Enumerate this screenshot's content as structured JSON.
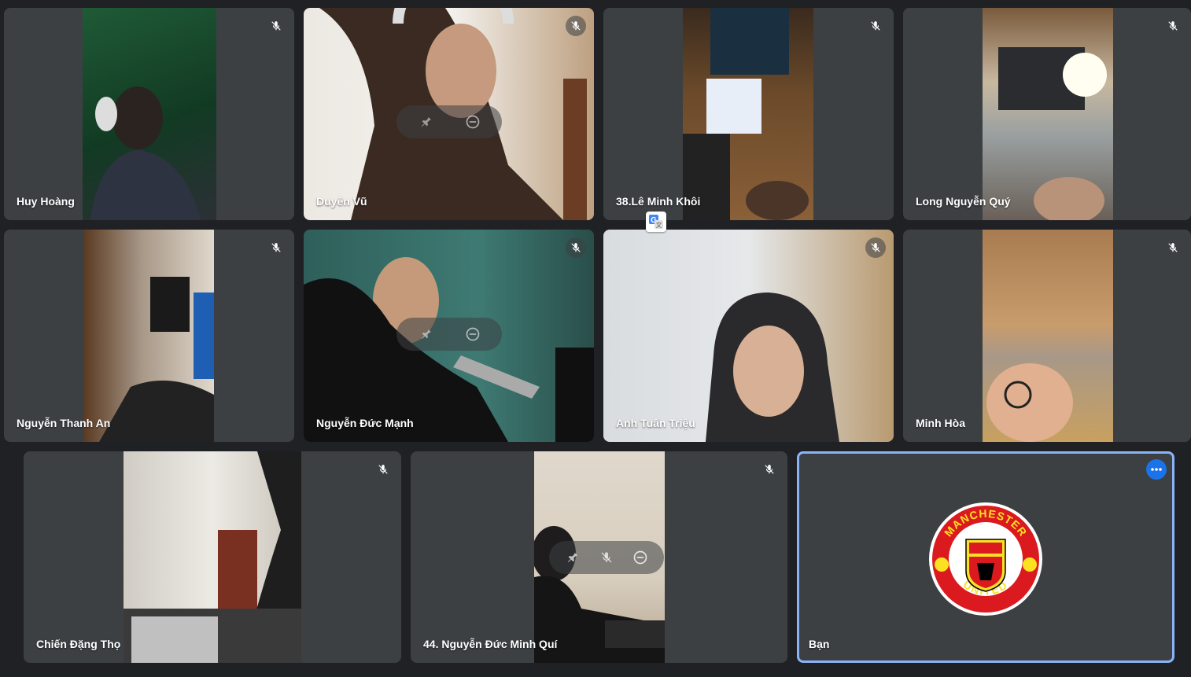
{
  "participants": [
    {
      "name": "Huy Hoàng",
      "muted": true
    },
    {
      "name": "Duyên Vũ",
      "muted": true
    },
    {
      "name": "38.Lê Minh Khôi",
      "muted": true
    },
    {
      "name": "Long Nguyễn Quý",
      "muted": true
    },
    {
      "name": "Nguyễn Thanh An",
      "muted": true
    },
    {
      "name": "Nguyễn Đức Mạnh",
      "muted": true
    },
    {
      "name": "Anh Tuấn Triệu",
      "muted": true
    },
    {
      "name": "Minh Hòa",
      "muted": true
    },
    {
      "name": "Chiến Đặng Thọ",
      "muted": true
    },
    {
      "name": "44. Nguyễn Đức Minh Quí",
      "muted": true
    },
    {
      "name": "Bạn",
      "muted": false,
      "avatar": "manchester-united-logo"
    }
  ],
  "logo": {
    "top_text": "MANCHESTER",
    "bottom_text": "UNITED"
  },
  "colors": {
    "background": "#202124",
    "tile": "#3c4043",
    "self_border": "#8ab4f8",
    "more_button": "#1a73e8",
    "mu_red": "#da1a1f",
    "mu_yellow": "#fbe122"
  },
  "icons": [
    "mic-off-icon",
    "pin-icon",
    "remove-icon",
    "more-options-icon",
    "translate-icon"
  ]
}
